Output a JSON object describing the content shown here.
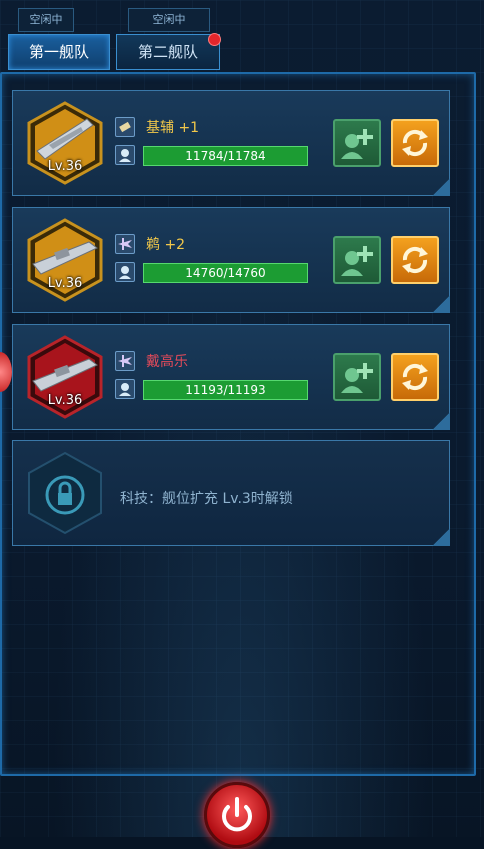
{
  "status_tabs": [
    "空闲中",
    "空闲中"
  ],
  "fleet_tabs": [
    {
      "label": "第一舰队",
      "active": true
    },
    {
      "label": "第二舰队",
      "active": false,
      "has_notification": true
    }
  ],
  "ships": [
    {
      "name": "基辅 +1",
      "name_color": "#f2c84a",
      "level": "Lv.36",
      "hp": "11784/11784",
      "hex_color": "gold",
      "type_icon": "ammo-icon"
    },
    {
      "name": "鹈 +2",
      "name_color": "#f2c84a",
      "level": "Lv.36",
      "hp": "14760/14760",
      "hex_color": "gold",
      "type_icon": "plane-icon"
    },
    {
      "name": "戴高乐",
      "name_color": "#e04a5a",
      "level": "Lv.36",
      "hp": "11193/11193",
      "hex_color": "red",
      "type_icon": "plane-icon"
    }
  ],
  "locked_slot": {
    "text": "科技：舰位扩充 Lv.3时解锁"
  },
  "colors": {
    "accent": "#3a8fd0",
    "hp_bar": "#1c9c33",
    "power": "#e3262b"
  }
}
